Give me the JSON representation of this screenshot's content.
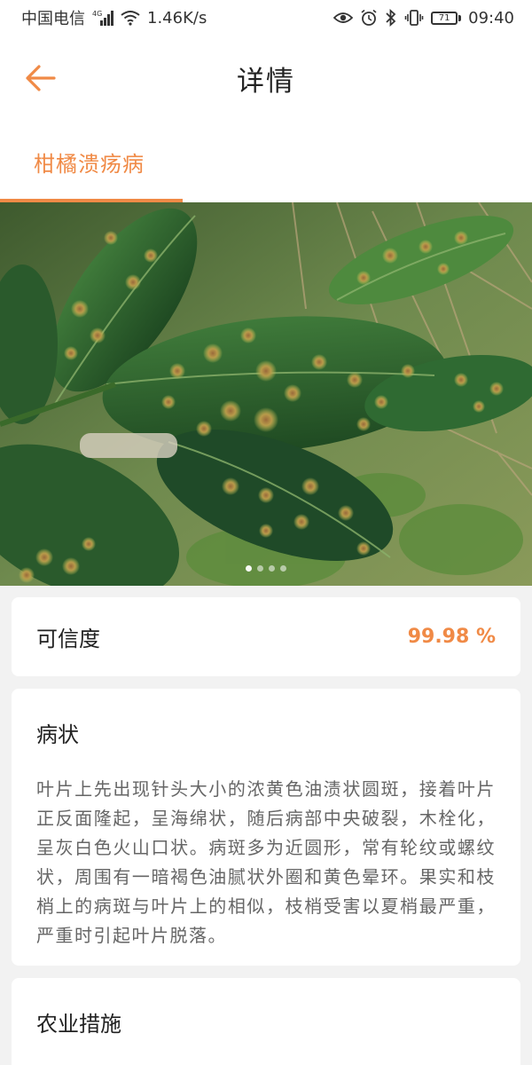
{
  "status_bar": {
    "carrier": "中国电信",
    "network": "4G",
    "speed": "1.46K/s",
    "battery": "71",
    "time": "09:40"
  },
  "header": {
    "title": "详情",
    "back_icon": "arrow-left-icon"
  },
  "tabs": [
    {
      "label": "柑橘溃疡病",
      "active": true
    }
  ],
  "carousel": {
    "dot_count": 4,
    "active_index": 0
  },
  "confidence": {
    "label": "可信度",
    "value": "99.98 %"
  },
  "symptoms": {
    "title": "病状",
    "text": "叶片上先出现针头大小的浓黄色油渍状圆斑，接着叶片正反面隆起，呈海绵状，随后病部中央破裂，木栓化，呈灰白色火山口状。病斑多为近圆形，常有轮纹或螺纹状，周围有一暗褐色油腻状外圈和黄色晕环。果实和枝梢上的病斑与叶片上的相似，枝梢受害以夏梢最严重，严重时引起叶片脱落。"
  },
  "agri_measures": {
    "title": "农业措施"
  },
  "colors": {
    "accent": "#f08a46",
    "background": "#f2f2f2",
    "card": "#ffffff"
  }
}
